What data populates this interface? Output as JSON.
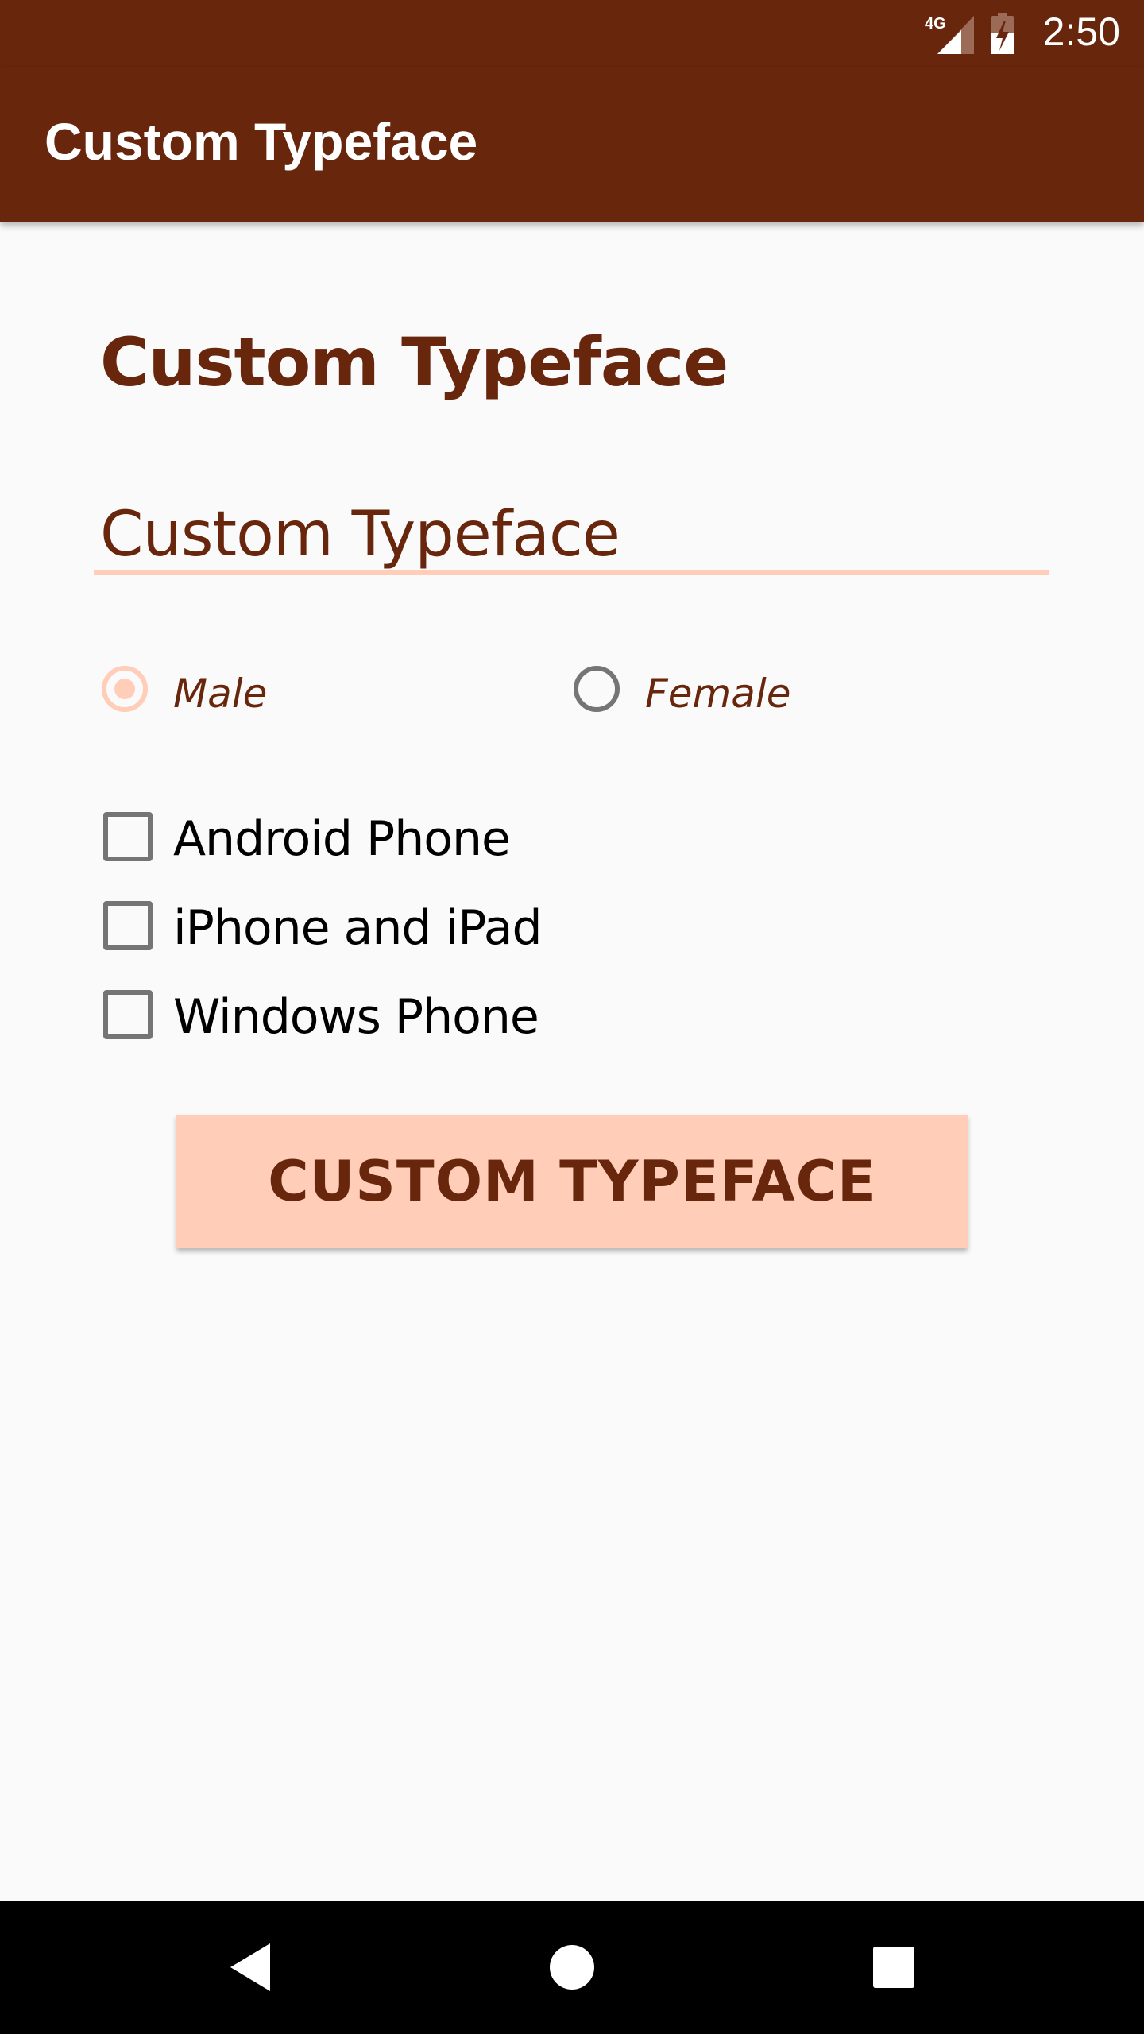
{
  "status_bar": {
    "time": "2:50",
    "network_label": "4G",
    "icons": [
      "signal-icon",
      "battery-charging-icon"
    ]
  },
  "app_bar": {
    "title": "Custom Typeface"
  },
  "content": {
    "heading": "Custom Typeface",
    "text_field": {
      "value": "Custom Typeface"
    },
    "gender_radios": [
      {
        "label": "Male",
        "checked": true
      },
      {
        "label": "Female",
        "checked": false
      }
    ],
    "device_checkboxes": [
      {
        "label": "Android Phone",
        "checked": false
      },
      {
        "label": "iPhone and iPad",
        "checked": false
      },
      {
        "label": "Windows Phone",
        "checked": false
      }
    ],
    "button_label": "CUSTOM TYPEFACE"
  },
  "nav_bar": {
    "icons": [
      "back-icon",
      "home-icon",
      "recents-icon"
    ]
  },
  "colors": {
    "primary": "#68260d",
    "accent": "#ffcdb8",
    "background": "#fafafa"
  }
}
